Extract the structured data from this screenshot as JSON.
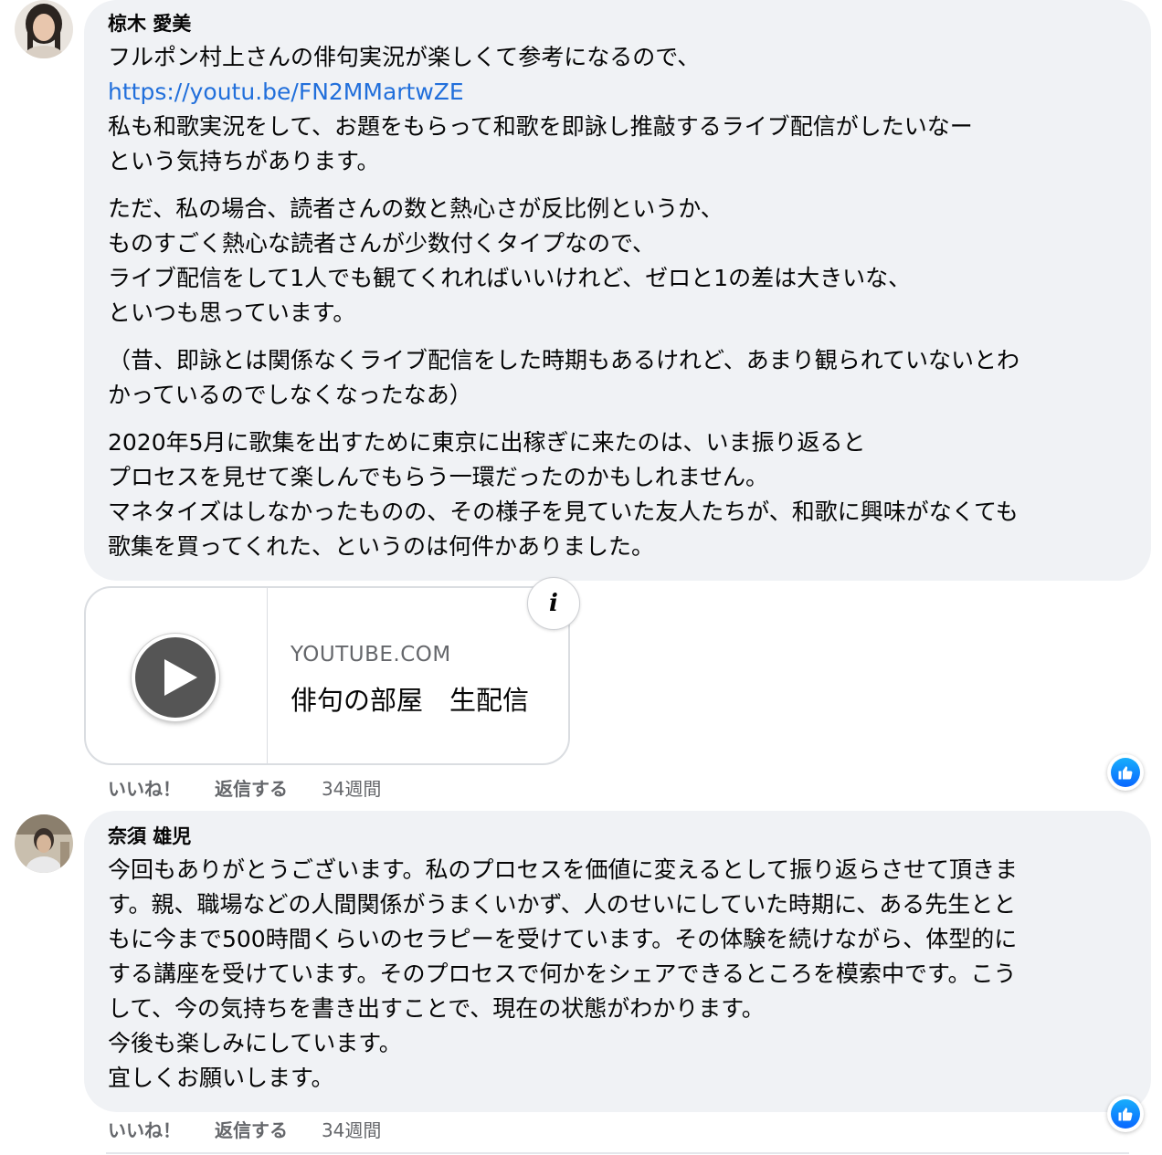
{
  "comments": [
    {
      "author": "椋木 愛美",
      "paragraphs": [
        [
          "フルポン村上さんの俳句実況が楽しくて参考になるので、",
          "https://youtu.be/FN2MMartwZE",
          "私も和歌実況をして、お題をもらって和歌を即詠し推敲するライブ配信がしたいなー",
          "という気持ちがあります。"
        ],
        [
          "ただ、私の場合、読者さんの数と熱心さが反比例というか、",
          "ものすごく熱心な読者さんが少数付くタイプなので、",
          "ライブ配信をして1人でも観てくれればいいけれど、ゼロと1の差は大きいな、",
          "といつも思っています。"
        ],
        [
          "（昔、即詠とは関係なくライブ配信をした時期もあるけれど、あまり観られていないとわ",
          "かっているのでしなくなったなあ）"
        ],
        [
          "2020年5月に歌集を出すために東京に出稼ぎに来たのは、いま振り返ると",
          "プロセスを見せて楽しんでもらう一環だったのかもしれません。",
          "マネタイズはしなかったものの、その様子を見ていた友人たちが、和歌に興味がなくても",
          "歌集を買ってくれた、というのは何件かありました。"
        ]
      ],
      "link_card": {
        "domain": "YOUTUBE.COM",
        "title": "俳句の部屋　生配信"
      },
      "actions": {
        "like": "いいね！",
        "reply": "返信する",
        "time": "34週間"
      }
    },
    {
      "author": "奈須 雄児",
      "paragraphs": [
        [
          "今回もありがとうございます。私のプロセスを価値に変えるとして振り返らさせて頂きま",
          "す。親、職場などの人間関係がうまくいかず、人のせいにしていた時期に、ある先生とと",
          "もに今まで500時間くらいのセラピーを受けています。その体験を続けながら、体型的に",
          "する講座を受けています。そのプロセスで何かをシェアできるところを模索中です。こう",
          "して、今の気持ちを書き出すことで、現在の状態がわかります。",
          "今後も楽しみにしています。",
          "宜しくお願いします。"
        ]
      ],
      "actions": {
        "like": "いいね！",
        "reply": "返信する",
        "time": "34週間"
      }
    }
  ],
  "icons": {
    "reaction": "thumbs-up-icon",
    "info": "info-icon",
    "play": "play-icon"
  },
  "colors": {
    "link": "#216fdb",
    "reaction": "#0866ff",
    "bubble": "#f0f2f5"
  }
}
